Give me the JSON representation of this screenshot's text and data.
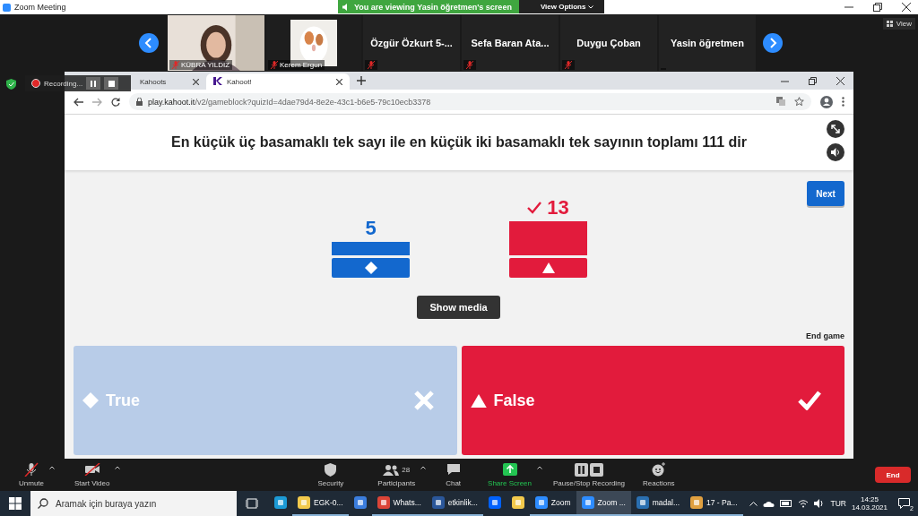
{
  "zoom_titlebar": {
    "title": "Zoom Meeting",
    "banner": "You are viewing Yasin öğretmen's screen",
    "view_options": "View Options"
  },
  "gallery": {
    "view": "View",
    "participants": [
      {
        "name": "KÜBRA YILDIZ",
        "kind": "picture",
        "muted": true
      },
      {
        "name": "Kerem Ergun",
        "kind": "picture",
        "muted": true
      },
      {
        "name": "Özgür Özkurt 5-...",
        "kind": "name",
        "muted": true
      },
      {
        "name": "Sefa Baran Ata...",
        "kind": "name",
        "muted": true
      },
      {
        "name": "Duygu Çoban",
        "kind": "name",
        "muted": true
      },
      {
        "name": "Yasin öğretmen",
        "kind": "name",
        "muted": false
      }
    ]
  },
  "recording": {
    "label": "Recording..."
  },
  "browser": {
    "tabs": [
      {
        "title": "Kahoots",
        "selected": false
      },
      {
        "title": "Kahoot!",
        "selected": true
      }
    ],
    "url_host": "play.kahoot.it",
    "url_path": "/v2/gameblock?quizId=4dae79d4-8e2e-43c1-b6e5-79c10ecb3378"
  },
  "kahoot": {
    "question": "En küçük üç basamaklı tek sayı ile en küçük iki basamaklı tek sayının toplamı 111 dir",
    "next": "Next",
    "show_media": "Show media",
    "end_game": "End game",
    "results": [
      {
        "count": "5",
        "kind": "diamond",
        "color": "#1368ce",
        "correct": false
      },
      {
        "count": "13",
        "kind": "triangle",
        "color": "#e21b3c",
        "correct": true
      }
    ],
    "answers": [
      {
        "label": "True",
        "kind": "diamond",
        "color": "#b8cce8",
        "correct": false
      },
      {
        "label": "False",
        "kind": "triangle",
        "color": "#e21b3c",
        "correct": true
      }
    ]
  },
  "toolbar": {
    "items": [
      {
        "label": "Unmute",
        "kind": "mic",
        "menu": true
      },
      {
        "label": "Start Video",
        "kind": "video",
        "menu": true
      },
      {
        "label": "Security",
        "kind": "shield"
      },
      {
        "label": "Participants",
        "kind": "people",
        "count": "28",
        "menu": true
      },
      {
        "label": "Chat",
        "kind": "chat"
      },
      {
        "label": "Share Screen",
        "kind": "share",
        "menu": true
      },
      {
        "label": "Pause/Stop Recording",
        "kind": "record"
      },
      {
        "label": "Reactions",
        "kind": "react"
      }
    ],
    "end": "End"
  },
  "taskbar": {
    "search": "Aramak için buraya yazın",
    "apps": [
      {
        "kind": "edge",
        "active": false
      },
      {
        "kind": "folder",
        "label": "EGK-0...",
        "active": false
      },
      {
        "kind": "mail",
        "active": false
      },
      {
        "kind": "chrome",
        "label": "Whats...",
        "active": false
      },
      {
        "kind": "word",
        "label": "etkinlik...",
        "active": false
      },
      {
        "kind": "dropbox",
        "active": false
      },
      {
        "kind": "file",
        "active": false
      },
      {
        "kind": "zoom",
        "label": "Zoom",
        "active": false
      },
      {
        "kind": "zoom",
        "label": "Zoom ...",
        "active": true
      },
      {
        "label": "madal...",
        "active": false
      },
      {
        "kind": "paint",
        "label": "17 - Pa...",
        "active": false
      }
    ],
    "lang": "TUR",
    "time": "14:25",
    "date": "14.03.2021",
    "notifications": "2"
  }
}
